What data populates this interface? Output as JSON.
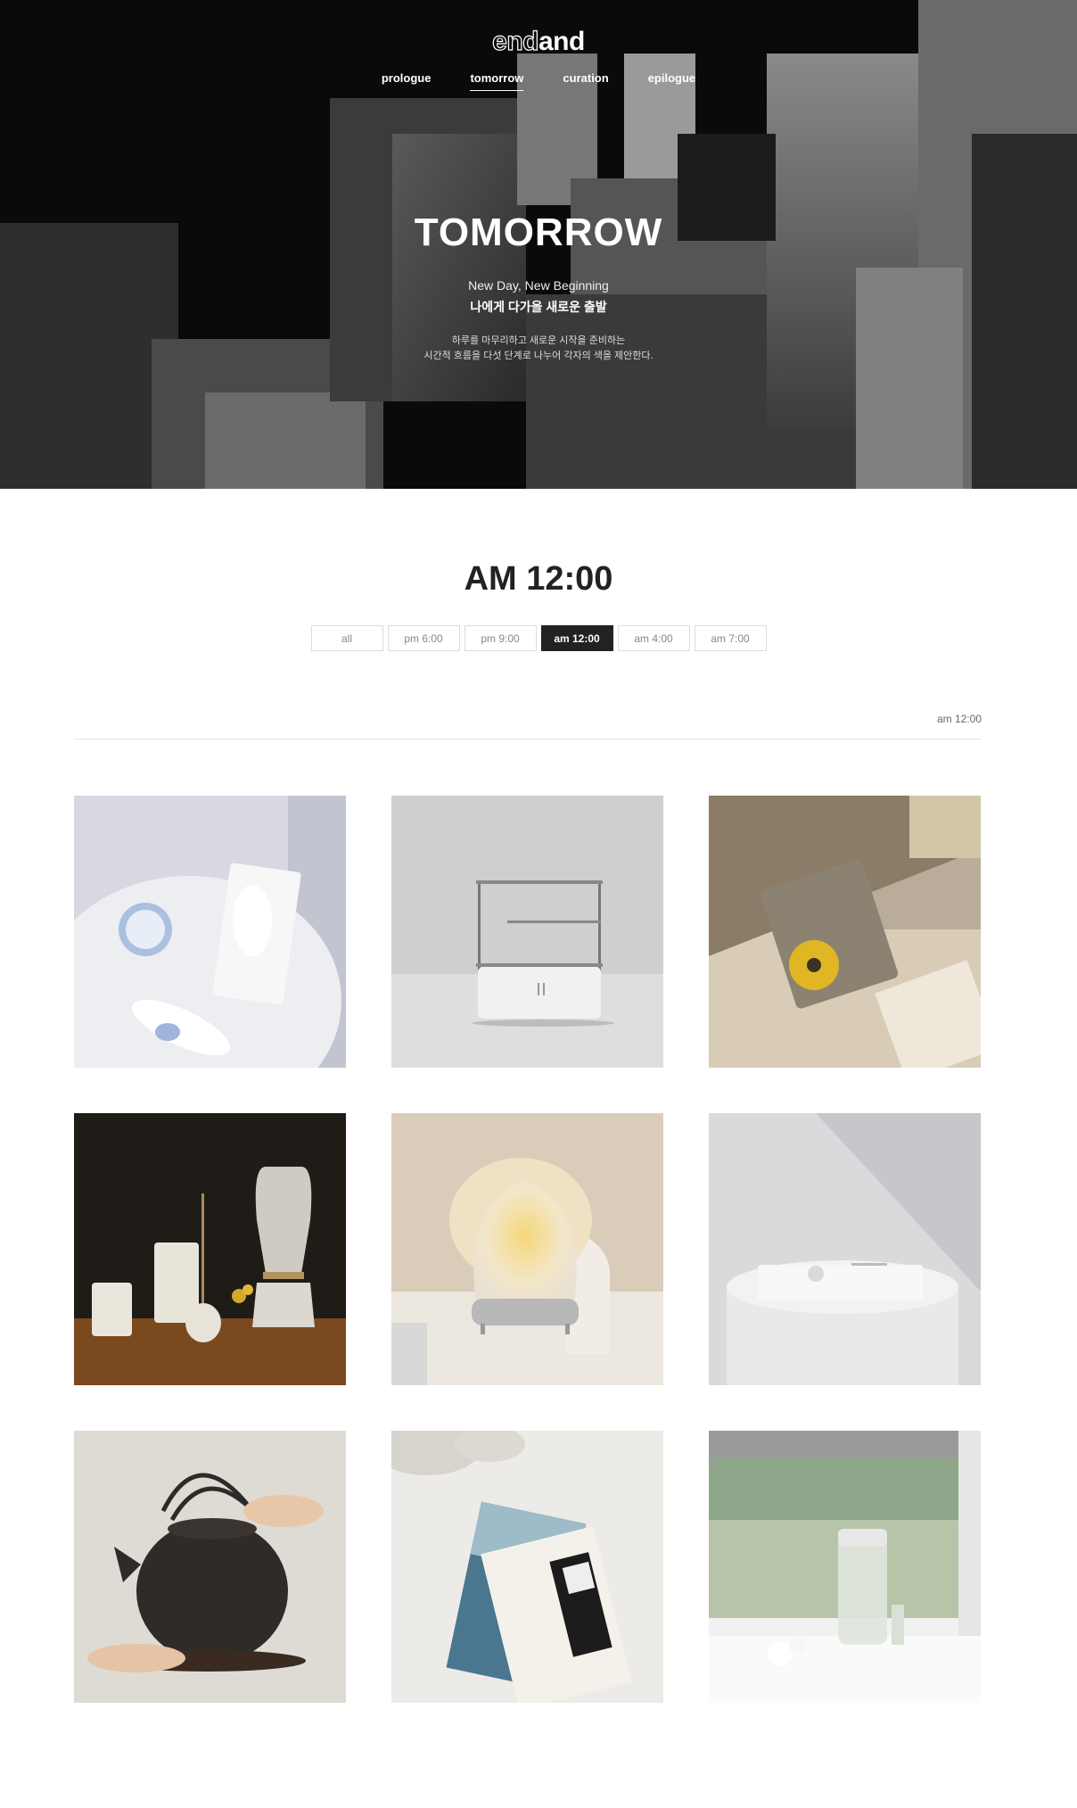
{
  "brand": {
    "logo_outline": "end",
    "logo_solid": "and"
  },
  "nav": {
    "items": [
      "prologue",
      "tomorrow",
      "curation",
      "epilogue"
    ],
    "active": "tomorrow"
  },
  "hero": {
    "title": "TOMORROW",
    "subtitle_en": "New Day, New Beginning",
    "subtitle_ko": "나에게 다가올 새로운 출발",
    "desc_line1": "하루를 마무리하고 새로운 시작을 준비하는",
    "desc_line2": "시간적 흐름을 다섯 단계로 나누어 각자의 색을 제안한다."
  },
  "section": {
    "title": "AM 12:00",
    "filters": [
      "all",
      "pm 6:00",
      "pm 9:00",
      "am 12:00",
      "am 4:00",
      "am 7:00"
    ],
    "active_filter": "am 12:00",
    "breadcrumb": "am 12:00"
  },
  "products": [
    {
      "name": "facial-device-set"
    },
    {
      "name": "glass-shelf-cabinet"
    },
    {
      "name": "cd-player-on-bed"
    },
    {
      "name": "tea-canisters-diffuser"
    },
    {
      "name": "mood-lamp"
    },
    {
      "name": "turntable-on-pedestal"
    },
    {
      "name": "black-teapot"
    },
    {
      "name": "postcards-on-bed"
    },
    {
      "name": "humidifier-by-window"
    }
  ]
}
